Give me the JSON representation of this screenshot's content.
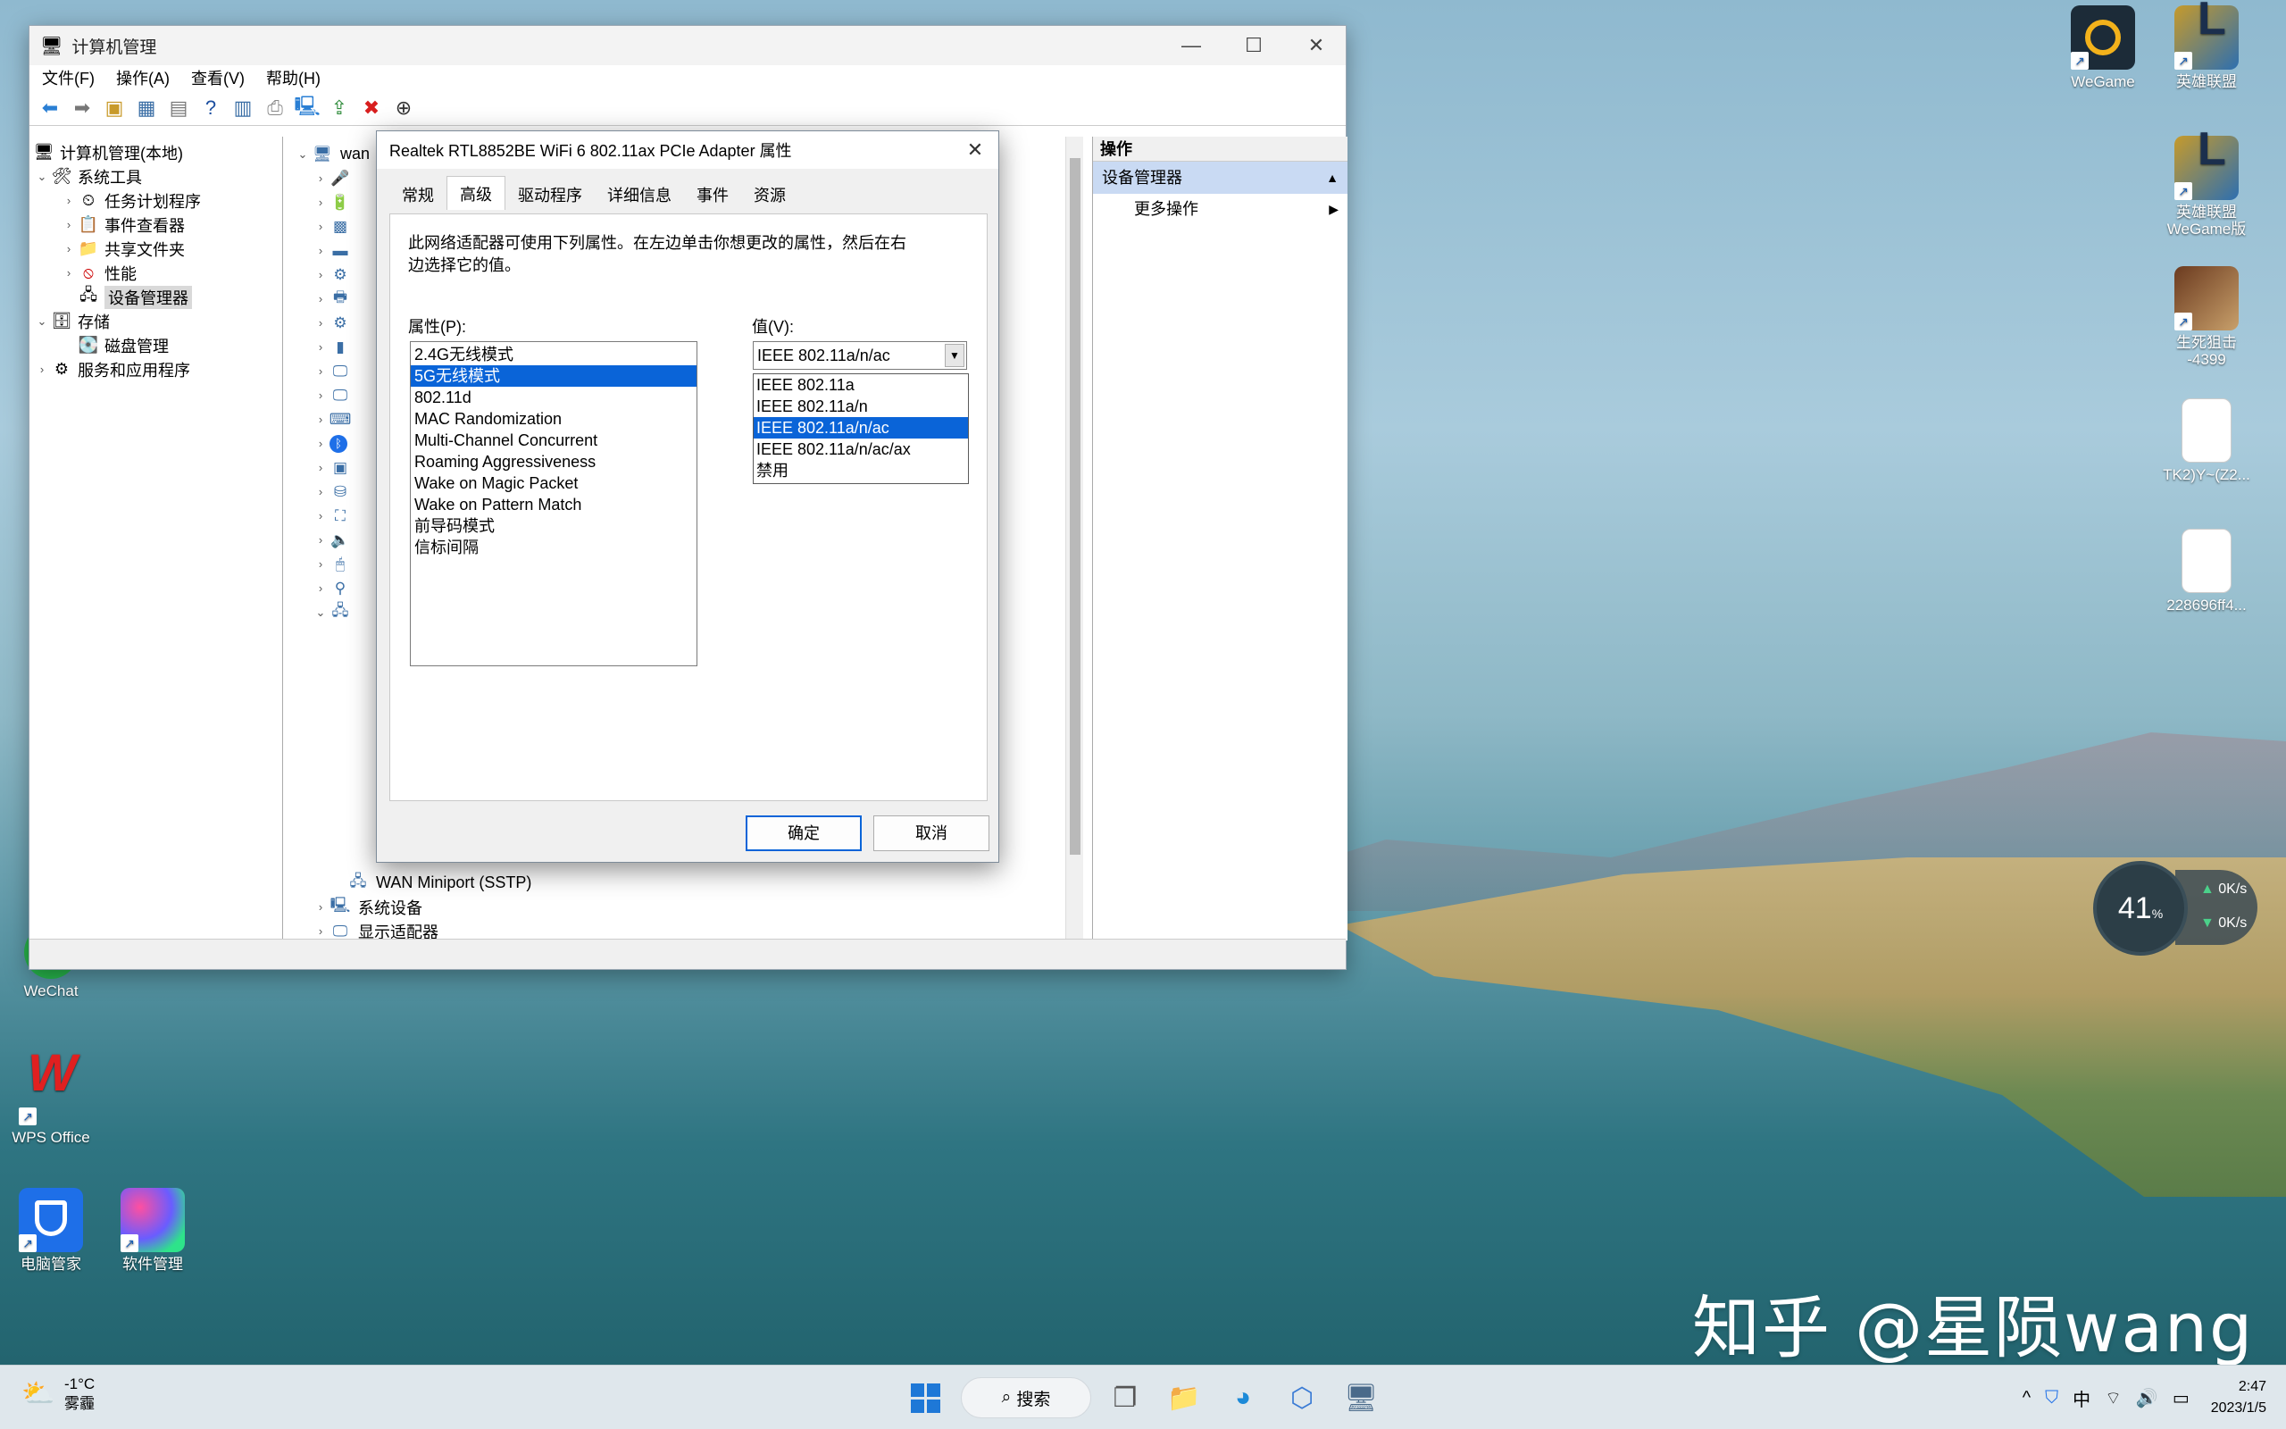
{
  "desktop": {
    "watermark": "知乎 @星陨wang",
    "icons": [
      {
        "label": "WeGame"
      },
      {
        "label": "英雄联盟"
      },
      {
        "label": "英雄联盟 WeGame版"
      },
      {
        "label": "生死狙击 -4399"
      },
      {
        "label": "TK2)Y~(Z2..."
      },
      {
        "label": "228696ff4..."
      },
      {
        "label": "WeChat"
      },
      {
        "label": "WPS Office"
      },
      {
        "label": "电脑管家"
      },
      {
        "label": "软件管理"
      }
    ],
    "net_widget": {
      "percent": "41",
      "percent_unit": "%",
      "up": "0K/s",
      "down": "0K/s"
    }
  },
  "window": {
    "title": "计算机管理",
    "menu": [
      "文件(F)",
      "操作(A)",
      "查看(V)",
      "帮助(H)"
    ],
    "tree": [
      {
        "label": "计算机管理(本地)"
      },
      {
        "label": "系统工具"
      },
      {
        "label": "任务计划程序"
      },
      {
        "label": "事件查看器"
      },
      {
        "label": "共享文件夹"
      },
      {
        "label": "性能"
      },
      {
        "label": "设备管理器"
      },
      {
        "label": "存储"
      },
      {
        "label": "磁盘管理"
      },
      {
        "label": "服务和应用程序"
      }
    ],
    "device_root": "wan",
    "device_rows": {
      "wan_sstp": "WAN Miniport (SSTP)",
      "system_devices": "系统设备",
      "display_adapters": "显示适配器"
    },
    "actions": {
      "header": "操作",
      "section": "设备管理器",
      "more": "更多操作"
    }
  },
  "dialog": {
    "title": "Realtek RTL8852BE WiFi 6 802.11ax PCIe Adapter 属性",
    "tabs": [
      "常规",
      "高级",
      "驱动程序",
      "详细信息",
      "事件",
      "资源"
    ],
    "active_tab": "高级",
    "description": "此网络适配器可使用下列属性。在左边单击你想更改的属性，然后在右边选择它的值。",
    "property_label": "属性(P):",
    "value_label": "值(V):",
    "properties": [
      "2.4G无线模式",
      "5G无线模式",
      "802.11d",
      "MAC Randomization",
      "Multi-Channel Concurrent",
      "Roaming Aggressiveness",
      "Wake on Magic Packet",
      "Wake on Pattern Match",
      "前导码模式",
      "信标间隔"
    ],
    "selected_property": "5G无线模式",
    "value_selected": "IEEE 802.11a/n/ac",
    "value_options": [
      "IEEE 802.11a",
      "IEEE 802.11a/n",
      "IEEE 802.11a/n/ac",
      "IEEE 802.11a/n/ac/ax",
      "禁用"
    ],
    "ok": "确定",
    "cancel": "取消"
  },
  "taskbar": {
    "weather_temp": "-1°C",
    "weather_desc": "雾霾",
    "search": "搜索",
    "ime": "中",
    "time": "2:47",
    "date": "2023/1/5"
  }
}
